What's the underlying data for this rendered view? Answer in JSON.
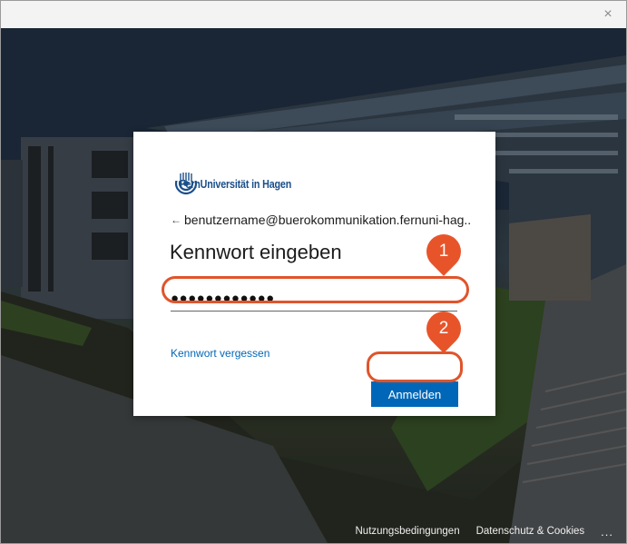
{
  "dialog": {
    "logo_text": "FernUniversität in Hagen",
    "identity_arrow": "←",
    "identity": "benutzername@buerokommunikation.fernuni-hag..",
    "heading": "Kennwort eingeben",
    "password_mask": "●●●●●●●●●●●●",
    "forgot_link": "Kennwort vergessen",
    "signin_button": "Anmelden"
  },
  "annotations": {
    "step1": "1",
    "step2": "2",
    "color": "#e8542a"
  },
  "footer": {
    "terms": "Nutzungsbedingungen",
    "privacy": "Datenschutz & Cookies",
    "more": "..."
  },
  "window": {
    "close_icon": "×"
  },
  "colors": {
    "accent": "#0067b8",
    "annotation": "#e8542a"
  }
}
